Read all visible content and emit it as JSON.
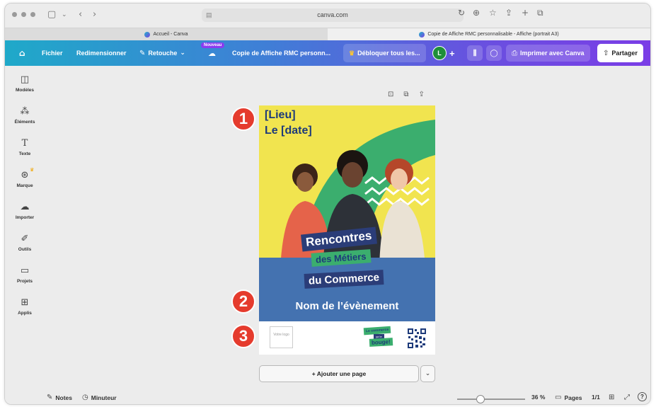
{
  "browser": {
    "url": "canva.com",
    "tabs": [
      {
        "label": "Accueil - Canva",
        "active": false
      },
      {
        "label": "Copie de Affiche RMC personnalisable - Affiche (portrait A3)",
        "active": true
      }
    ]
  },
  "toolbar": {
    "fichier": "Fichier",
    "redimensionner": "Redimensionner",
    "retouche": "Retouche",
    "nouveau_badge": "Nouveau",
    "doc_title": "Copie de Affiche RMC personn...",
    "unlock": "Débloquer tous les...",
    "avatar_initial": "L",
    "print": "Imprimer avec Canva",
    "share": "Partager"
  },
  "sidebar": {
    "items": [
      {
        "label": "Modèles",
        "icon": "layout-icon"
      },
      {
        "label": "Éléments",
        "icon": "shapes-icon"
      },
      {
        "label": "Texte",
        "icon": "text-icon"
      },
      {
        "label": "Marque",
        "icon": "brand-icon"
      },
      {
        "label": "Importer",
        "icon": "upload-cloud-icon"
      },
      {
        "label": "Outils",
        "icon": "pen-tool-icon"
      },
      {
        "label": "Projets",
        "icon": "folder-icon"
      },
      {
        "label": "Applis",
        "icon": "apps-grid-icon"
      }
    ]
  },
  "poster": {
    "lieu": "[Lieu]",
    "date": "Le [date]",
    "title_line1": "Rencontres",
    "title_line2": "des Métiers",
    "title_line3": "du Commerce",
    "event_name": "Nom de l’évènement",
    "logo_placeholder": "Votre logo",
    "badge_line1": "Le commerce",
    "badge_line2": "ça te",
    "badge_line3": "bouge!"
  },
  "markers": [
    "1",
    "2",
    "3"
  ],
  "add_page": "+ Ajouter une page",
  "footer": {
    "notes": "Notes",
    "timer": "Minuteur",
    "zoom": "36 %",
    "pages_label": "Pages",
    "pages_count": "1/1",
    "help": "?"
  },
  "colors": {
    "poster_yellow": "#f1e44f",
    "poster_green": "#3bae6e",
    "poster_blue": "#4472b0",
    "poster_navy": "#2b3d78",
    "marker_red": "#e53b2d"
  }
}
